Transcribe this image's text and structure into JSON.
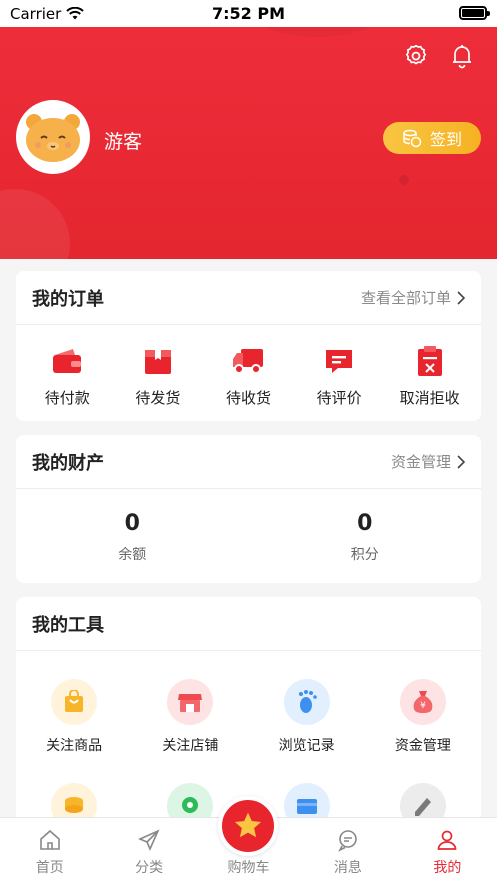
{
  "status_bar": {
    "carrier": "Carrier",
    "time": "7:52 PM"
  },
  "header": {
    "username": "游客",
    "checkin_label": "签到",
    "colors": {
      "primary": "#e4262f",
      "checkin": "#f5b223"
    }
  },
  "orders": {
    "title": "我的订单",
    "link": "查看全部订单",
    "items": [
      {
        "label": "待付款",
        "icon": "wallet-icon"
      },
      {
        "label": "待发货",
        "icon": "package-icon"
      },
      {
        "label": "待收货",
        "icon": "truck-icon"
      },
      {
        "label": "待评价",
        "icon": "comment-icon"
      },
      {
        "label": "取消拒收",
        "icon": "cancel-clipboard-icon"
      }
    ]
  },
  "assets": {
    "title": "我的财产",
    "link": "资金管理",
    "items": [
      {
        "value": "0",
        "label": "余额"
      },
      {
        "value": "0",
        "label": "积分"
      }
    ]
  },
  "tools": {
    "title": "我的工具",
    "items": [
      {
        "label": "关注商品",
        "icon": "shopping-bag-icon"
      },
      {
        "label": "关注店铺",
        "icon": "store-icon"
      },
      {
        "label": "浏览记录",
        "icon": "footprint-icon"
      },
      {
        "label": "资金管理",
        "icon": "money-bag-icon"
      },
      {
        "label": "",
        "icon": "coins-icon"
      },
      {
        "label": "",
        "icon": "location-icon"
      },
      {
        "label": "",
        "icon": "card-icon"
      },
      {
        "label": "",
        "icon": "pen-icon"
      }
    ]
  },
  "tabbar": {
    "items": [
      {
        "label": "首页",
        "icon": "home-icon"
      },
      {
        "label": "分类",
        "icon": "send-icon"
      },
      {
        "label": "购物车",
        "icon": "star-icon"
      },
      {
        "label": "消息",
        "icon": "chat-icon"
      },
      {
        "label": "我的",
        "icon": "user-icon"
      }
    ],
    "active": "我的"
  }
}
